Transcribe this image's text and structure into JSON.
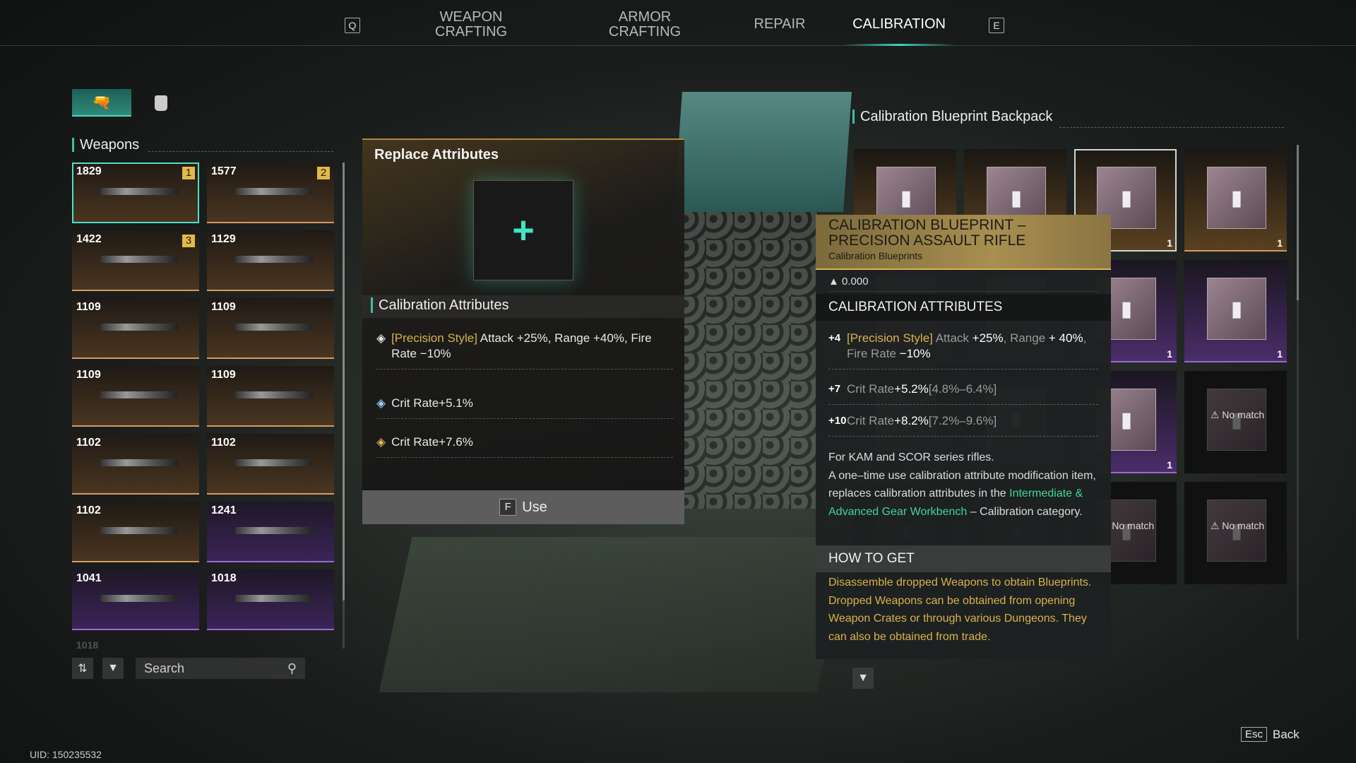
{
  "nav": {
    "left_key": "Q",
    "right_key": "E",
    "tabs": [
      {
        "label": "WEAPON\nCRAFTING",
        "line1": "WEAPON",
        "line2": "CRAFTING"
      },
      {
        "line1": "ARMOR",
        "line2": "CRAFTING"
      },
      {
        "line1": "REPAIR"
      },
      {
        "line1": "CALIBRATION",
        "active": true
      }
    ]
  },
  "left": {
    "tabs": [
      {
        "icon": "pistol-icon",
        "active": true
      },
      {
        "icon": "armor-vest-icon"
      }
    ],
    "section": "Weapons",
    "weapons": [
      {
        "score": "1829",
        "rank": "1",
        "rarity": "gold",
        "selected": true
      },
      {
        "score": "1577",
        "rank": "2",
        "rarity": "gold"
      },
      {
        "score": "1422",
        "rank": "3",
        "rarity": "gold"
      },
      {
        "score": "1129",
        "rarity": "gold"
      },
      {
        "score": "1109",
        "rarity": "gold"
      },
      {
        "score": "1109",
        "rarity": "gold"
      },
      {
        "score": "1109",
        "rarity": "gold"
      },
      {
        "score": "1109",
        "rarity": "gold"
      },
      {
        "score": "1102",
        "rarity": "gold"
      },
      {
        "score": "1102",
        "rarity": "gold"
      },
      {
        "score": "1102",
        "rarity": "gold"
      },
      {
        "score": "1241",
        "rarity": "purple"
      },
      {
        "score": "1041",
        "rarity": "purple"
      },
      {
        "score": "1018",
        "rarity": "purple"
      }
    ],
    "next_partial": "1018",
    "search_placeholder": "Search"
  },
  "replace": {
    "title": "Replace Attributes",
    "section": "Calibration Attributes",
    "attrs": [
      {
        "icon": "precision-style-icon",
        "color": "#e8e8e8",
        "tag": "[Precision Style]",
        "text": " Attack +25%, Range +40%, Fire Rate −10%"
      },
      {
        "icon": "crit-blue-icon",
        "color": "#9fd0ff",
        "text": "Crit Rate+5.1%"
      },
      {
        "icon": "crit-gold-icon",
        "color": "#e6b45a",
        "text": "Crit Rate+7.6%"
      }
    ],
    "use_key": "F",
    "use_label": "Use"
  },
  "backpack": {
    "title": "Calibration Blueprint Backpack",
    "no_match": "No match",
    "cells": [
      {
        "r": "gold"
      },
      {
        "r": "gold"
      },
      {
        "r": "gold",
        "count": "1",
        "selected": true
      },
      {
        "r": "gold",
        "count": "1"
      },
      {
        "r": "purple"
      },
      {
        "r": "purple"
      },
      {
        "r": "purple",
        "count": "1"
      },
      {
        "r": "purple",
        "count": "1"
      },
      {
        "r": "purple"
      },
      {
        "r": "purple"
      },
      {
        "r": "purple",
        "count": "1"
      },
      {
        "r": "none",
        "nomatch": true
      },
      {
        "r": "none"
      },
      {
        "r": "none"
      },
      {
        "r": "none",
        "nomatch": true
      },
      {
        "r": "none",
        "nomatch": true
      }
    ]
  },
  "tooltip": {
    "title": "CALIBRATION BLUEPRINT – PRECISION ASSAULT RIFLE",
    "category": "Calibration Blueprints",
    "weight": "0.000",
    "attr_header": "CALIBRATION ATTRIBUTES",
    "attrs": [
      {
        "level": "+4",
        "tag": "[Precision Style]",
        "html_parts": [
          "Attack",
          " +25%",
          ", Range ",
          "+ 40%",
          ", Fire Rate ",
          "−10%"
        ]
      },
      {
        "level": "+7",
        "name": "Crit Rate",
        "value": "+5.2%",
        "range": "[4.8%–6.4%]"
      },
      {
        "level": "+10",
        "name": "Crit Rate",
        "value": "+8.2%",
        "range": "[7.2%–9.6%]"
      }
    ],
    "desc1": "For KAM and SCOR series rifles.",
    "desc2": "A one–time use calibration attribute modification item, replaces calibration attributes in the ",
    "desc_link": "Intermediate & Advanced Gear Workbench",
    "desc3": " – Calibration category.",
    "how_header": "HOW TO GET",
    "how_text": "Disassemble dropped Weapons to obtain Blueprints. Dropped Weapons can be obtained from opening Weapon Crates or through various Dungeons. They can also be obtained from trade."
  },
  "footer": {
    "esc_key": "Esc",
    "back_label": "Back",
    "uid": "UID: 150235532"
  },
  "colors": {
    "accent": "#3fd6bd",
    "gold": "#d8b24c",
    "purple": "#9a6ad6",
    "link": "#3fd69a"
  }
}
